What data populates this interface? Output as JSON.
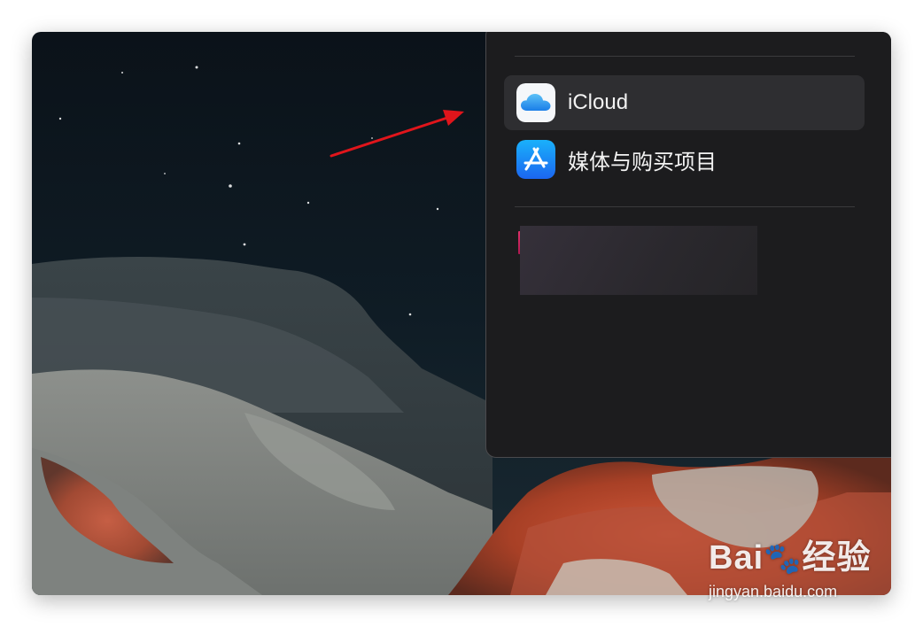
{
  "settings_panel": {
    "items": [
      {
        "label": "iCloud",
        "icon": "icloud-icon",
        "selected": true
      },
      {
        "label": "媒体与购买项目",
        "icon": "app-store-icon",
        "selected": false
      }
    ]
  },
  "annotation": {
    "color": "#e0151b",
    "icon": "red-arrow-pointer"
  },
  "watermark": {
    "brand": "Bai",
    "brand_suffix": "经验",
    "url": "jingyan.baidu.com"
  }
}
